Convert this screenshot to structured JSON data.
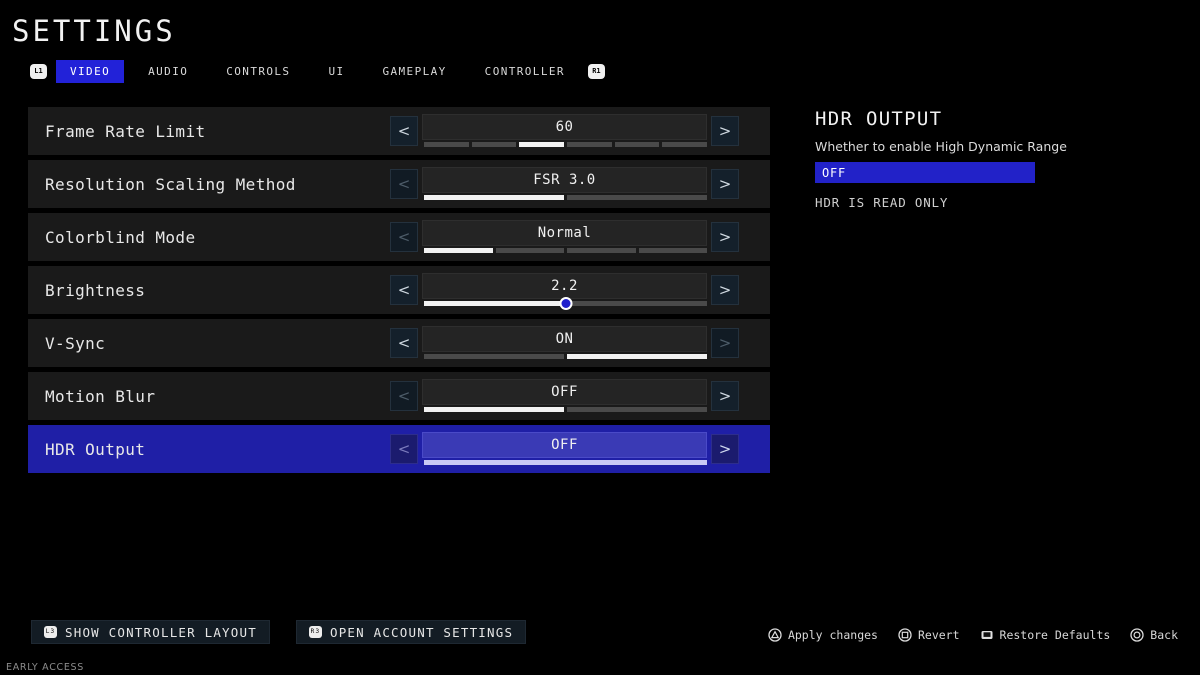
{
  "page_title": "SETTINGS",
  "colors": {
    "accent_blue": "#2222d8",
    "row_selected": "#1f1fa6",
    "row_bg": "#1a1a1a",
    "background": "#000000",
    "value_box": "#242424",
    "slider_knob": "#2020cc"
  },
  "tabbar": {
    "left_bumper": "L1",
    "right_bumper": "R1",
    "tabs": [
      {
        "label": "VIDEO",
        "active": true
      },
      {
        "label": "AUDIO",
        "active": false
      },
      {
        "label": "CONTROLS",
        "active": false
      },
      {
        "label": "UI",
        "active": false
      },
      {
        "label": "GAMEPLAY",
        "active": false
      },
      {
        "label": "CONTROLLER",
        "active": false
      }
    ]
  },
  "settings": [
    {
      "label": "Frame Rate Limit",
      "value": "60",
      "control": "segments",
      "segments": 6,
      "active_segment": 3,
      "selected": false,
      "left_arrow": "<",
      "right_arrow": ">",
      "left_enabled": true,
      "right_enabled": true
    },
    {
      "label": "Resolution Scaling Method",
      "value": "FSR 3.0",
      "control": "segments",
      "segments": 2,
      "active_segment": 1,
      "selected": false,
      "left_arrow": "<",
      "right_arrow": ">",
      "left_enabled": false,
      "right_enabled": true
    },
    {
      "label": "Colorblind Mode",
      "value": "Normal",
      "control": "segments",
      "segments": 4,
      "active_segment": 1,
      "selected": false,
      "left_arrow": "<",
      "right_arrow": ">",
      "left_enabled": false,
      "right_enabled": true
    },
    {
      "label": "Brightness",
      "value": "2.2",
      "control": "slider",
      "slider_percent": 50,
      "selected": false,
      "left_arrow": "<",
      "right_arrow": ">",
      "left_enabled": true,
      "right_enabled": true
    },
    {
      "label": "V-Sync",
      "value": "ON",
      "control": "segments",
      "segments": 2,
      "active_segment": 2,
      "selected": false,
      "left_arrow": "<",
      "right_arrow": ">",
      "left_enabled": true,
      "right_enabled": false
    },
    {
      "label": "Motion Blur",
      "value": "OFF",
      "control": "segments",
      "segments": 2,
      "active_segment": 1,
      "selected": false,
      "left_arrow": "<",
      "right_arrow": ">",
      "left_enabled": false,
      "right_enabled": true
    },
    {
      "label": "HDR Output",
      "value": "OFF",
      "control": "segments",
      "segments": 1,
      "active_segment": 1,
      "selected": true,
      "left_arrow": "<",
      "right_arrow": ">",
      "left_enabled": false,
      "right_enabled": true
    }
  ],
  "info_panel": {
    "title": "HDR OUTPUT",
    "description": "Whether to enable High Dynamic Range",
    "value": "OFF",
    "note": "HDR IS READ ONLY"
  },
  "bottom_actions": [
    {
      "glyph": "L3",
      "label": "SHOW CONTROLLER LAYOUT"
    },
    {
      "glyph": "R3",
      "label": "OPEN ACCOUNT SETTINGS"
    }
  ],
  "bottom_hints": [
    {
      "icon": "triangle-button-icon",
      "label": "Apply changes"
    },
    {
      "icon": "square-button-icon",
      "label": "Revert"
    },
    {
      "icon": "touchpad-button-icon",
      "label": "Restore Defaults"
    },
    {
      "icon": "circle-button-icon",
      "label": "Back"
    }
  ],
  "footer": {
    "early_access": "EARLY ACCESS"
  }
}
